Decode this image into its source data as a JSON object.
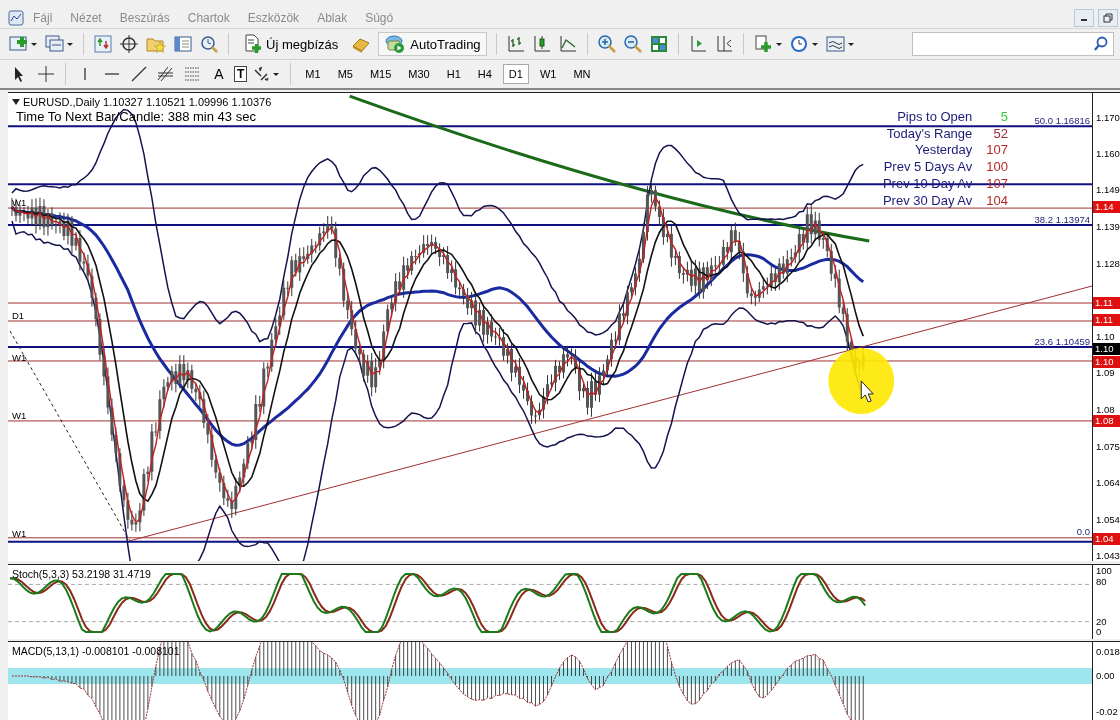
{
  "menu": [
    {
      "label": "Fájl"
    },
    {
      "label": "Nézet"
    },
    {
      "label": "Beszúrás"
    },
    {
      "label": "Chartok"
    },
    {
      "label": "Eszközök"
    },
    {
      "label": "Ablak"
    },
    {
      "label": "Súgó"
    }
  ],
  "toolbar": {
    "new_order": "Új megbízás",
    "autotrading": "AutoTrading"
  },
  "drawing_tools": {
    "text_tool": "A",
    "label_tool": "T"
  },
  "timeframes": [
    {
      "label": "M1",
      "selected": false
    },
    {
      "label": "M5",
      "selected": false
    },
    {
      "label": "M15",
      "selected": false
    },
    {
      "label": "M30",
      "selected": false
    },
    {
      "label": "H1",
      "selected": false
    },
    {
      "label": "H4",
      "selected": false
    },
    {
      "label": "D1",
      "selected": true
    },
    {
      "label": "W1",
      "selected": false
    },
    {
      "label": "MN",
      "selected": false
    }
  ],
  "chart": {
    "title": "EURUSD.,Daily 1.10327 1.10521 1.09996 1.10376",
    "timer": "Time To Next Bar/Candle: 388 min 43 sec",
    "info": [
      {
        "label": "Pips to Open",
        "value": "5",
        "color": "#3cc83c"
      },
      {
        "label": "Today's Range",
        "value": "52",
        "color": "#a0283c"
      },
      {
        "label": "Yesterday",
        "value": "107",
        "color": "#b42828"
      },
      {
        "label": "Prev 5 Days Av",
        "value": "100",
        "color": "#b42828"
      },
      {
        "label": "Prev 10 Day Av",
        "value": "107",
        "color": "#b42828"
      },
      {
        "label": "Prev 30 Day Av",
        "value": "104",
        "color": "#b42828"
      }
    ],
    "fib_labels": [
      "50.0 1.16816",
      "38.2 1.13974",
      "23.6 1.10459",
      "0.0"
    ],
    "period_labels": [
      "W1",
      "D1",
      "W1",
      "W1",
      "W1"
    ],
    "price_axis": [
      "1.170",
      "1.160",
      "1.149",
      "1.139",
      "1.128",
      "1.10",
      "1.09",
      "1.08",
      "1.075",
      "1.064",
      "1.054",
      "1.043"
    ],
    "price_tags": [
      {
        "text": "1.14",
        "color": "#e01010"
      },
      {
        "text": "1.11",
        "color": "#e01010"
      },
      {
        "text": "1.11",
        "color": "#e01010"
      },
      {
        "text": "1.10",
        "color": "#000000"
      },
      {
        "text": "1.10",
        "color": "#e01010"
      },
      {
        "text": "1.08",
        "color": "#e01010"
      },
      {
        "text": "1.04",
        "color": "#e01010"
      }
    ]
  },
  "stochastic": {
    "title": "Stoch(5,3,3) 53.2198 31.4719",
    "axis": [
      "100",
      "80",
      "20",
      "0"
    ]
  },
  "macd": {
    "title": "MACD(5,13,1) -0.008101 -0.008101",
    "axis": [
      "0.018",
      "0.00",
      "-0.02"
    ]
  }
}
